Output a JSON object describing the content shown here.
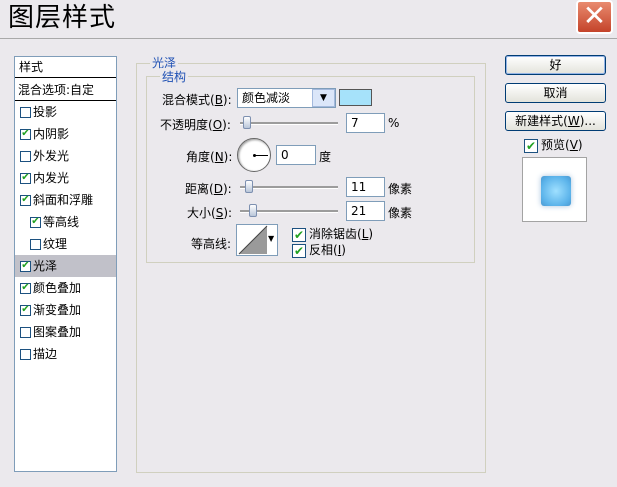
{
  "window": {
    "title": "图层样式",
    "close_symbol": "✕"
  },
  "styles_list": {
    "header": "样式",
    "blend_options": "混合选项:自定",
    "items": [
      {
        "label": "投影",
        "checked": false,
        "indent": false,
        "selected": false
      },
      {
        "label": "内阴影",
        "checked": true,
        "indent": false,
        "selected": false
      },
      {
        "label": "外发光",
        "checked": false,
        "indent": false,
        "selected": false
      },
      {
        "label": "内发光",
        "checked": true,
        "indent": false,
        "selected": false
      },
      {
        "label": "斜面和浮雕",
        "checked": true,
        "indent": false,
        "selected": false
      },
      {
        "label": "等高线",
        "checked": true,
        "indent": true,
        "selected": false
      },
      {
        "label": "纹理",
        "checked": false,
        "indent": true,
        "selected": false
      },
      {
        "label": "光泽",
        "checked": true,
        "indent": false,
        "selected": true
      },
      {
        "label": "颜色叠加",
        "checked": true,
        "indent": false,
        "selected": false
      },
      {
        "label": "渐变叠加",
        "checked": true,
        "indent": false,
        "selected": false
      },
      {
        "label": "图案叠加",
        "checked": false,
        "indent": false,
        "selected": false
      },
      {
        "label": "描边",
        "checked": false,
        "indent": false,
        "selected": false
      }
    ]
  },
  "satin": {
    "section_title": "光泽",
    "group_title": "结构",
    "blend_mode": {
      "label_pre": "混合模式(",
      "key": "B",
      "label_post": "):",
      "value": "颜色减淡",
      "color": "#a6e2fa"
    },
    "opacity": {
      "label_pre": "不透明度(",
      "key": "O",
      "label_post": "):",
      "value": "7",
      "unit": "%",
      "level_percent": 7
    },
    "angle": {
      "label_pre": "角度(",
      "key": "N",
      "label_post": "):",
      "value": "0",
      "unit": "度"
    },
    "distance": {
      "label_pre": "距离(",
      "key": "D",
      "label_post": "):",
      "value": "11",
      "unit": "像素"
    },
    "size": {
      "label_pre": "大小(",
      "key": "S",
      "label_post": "):",
      "value": "21",
      "unit": "像素"
    },
    "contour": {
      "label": "等高线:"
    },
    "anti_alias": {
      "label_pre": "消除锯齿(",
      "key": "L",
      "label_post": ")",
      "checked": true
    },
    "invert": {
      "label_pre": "反相(",
      "key": "I",
      "label_post": ")",
      "checked": true
    }
  },
  "buttons": {
    "ok": "好",
    "cancel": "取消",
    "new_style_pre": "新建样式(",
    "new_style_key": "W",
    "new_style_post": ")...",
    "preview_pre": "预览(",
    "preview_key": "V",
    "preview_post": ")",
    "preview_checked": true
  }
}
